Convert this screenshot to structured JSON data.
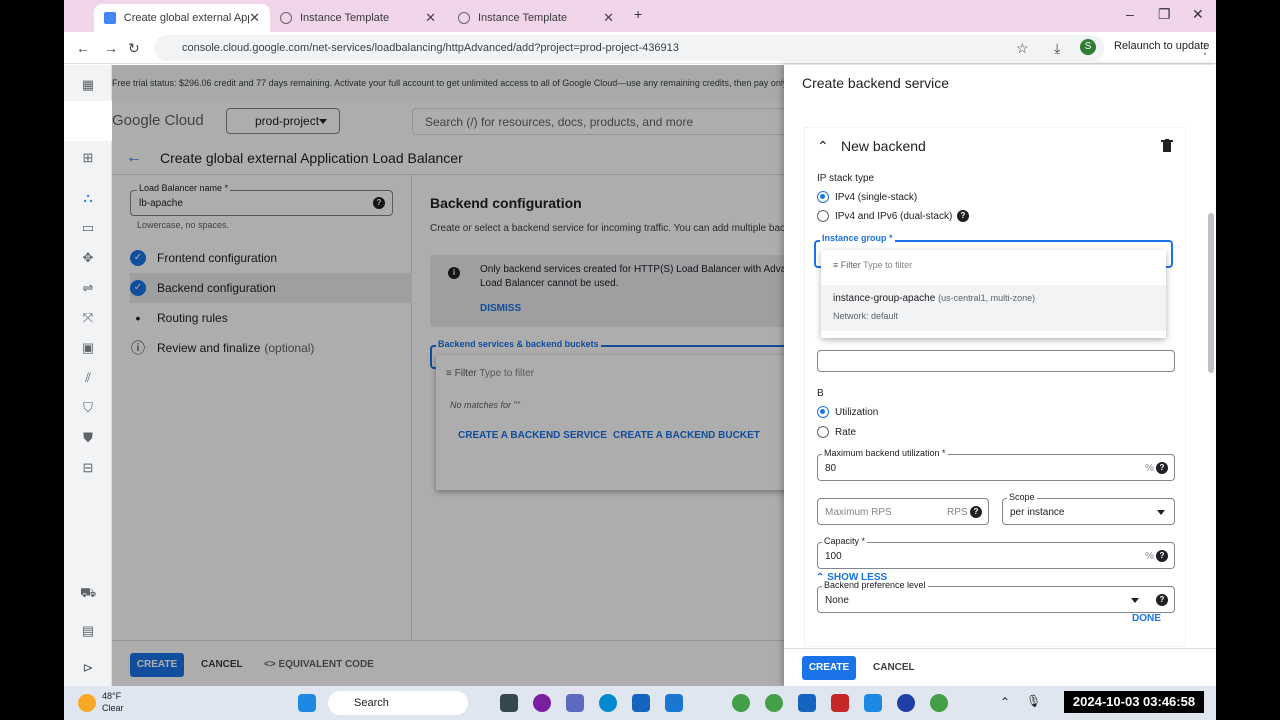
{
  "browser": {
    "tabs": [
      {
        "label": "Create global external Applicati",
        "active": true
      },
      {
        "label": "Instance Template",
        "active": false
      },
      {
        "label": "Instance Template",
        "active": false
      }
    ],
    "url": "console.cloud.google.com/net-services/loadbalancing/httpAdvanced/add?project=prod-project-436913",
    "relaunch_label": "Relaunch to update",
    "profile_initial": "S"
  },
  "console": {
    "trial_text": "Free trial status: $296.06 credit and 77 days remaining. Activate your full account to get unlimited access to all of Google Cloud—use any remaining credits, then pay only",
    "logo": "Google Cloud",
    "project": "prod-project",
    "search_placeholder": "Search (/) for resources, docs, products, and more",
    "page_title": "Create global external Application Load Balancer",
    "lb_name_label": "Load Balancer name *",
    "lb_name_value": "lb-apache",
    "lb_name_hint": "Lowercase, no spaces.",
    "steps": [
      {
        "label": "Frontend configuration",
        "state": "done"
      },
      {
        "label": "Backend configuration",
        "state": "done"
      },
      {
        "label": "Routing rules",
        "state": "todo"
      },
      {
        "label": "Review and finalize",
        "state": "info",
        "suffix": "(optional)"
      }
    ],
    "main_title": "Backend configuration",
    "main_desc": "Create or select a backend service for incoming traffic. You can add multiple backe",
    "info_text": "Only backend services created for HTTP(S) Load Balancer with Advanc Load Balancer cannot be used.",
    "dismiss_label": "DISMISS",
    "bs_label": "Backend services & backend buckets",
    "bs_filter": "Filter",
    "bs_filter_placeholder": "Type to filter",
    "no_matches": "No matches for \"\"",
    "create_backend_service": "CREATE A BACKEND SERVICE",
    "create_backend_bucket": "CREATE A BACKEND BUCKET",
    "create_label": "CREATE",
    "cancel_label": "CANCEL",
    "equivalent_code": "EQUIVALENT CODE"
  },
  "panel": {
    "title": "Create backend service",
    "new_backend": "New backend",
    "ip_stack_label": "IP stack type",
    "ip_options": [
      {
        "label": "IPv4 (single-stack)",
        "selected": true
      },
      {
        "label": "IPv4 and IPv6 (dual-stack)",
        "selected": false
      }
    ],
    "instance_group_label": "Instance group *",
    "ig_filter": "Filter",
    "ig_filter_placeholder": "Type to filter",
    "ig_option_name": "instance-group-apache",
    "ig_option_zone": "(us-central1, multi-zone)",
    "ig_option_network": "Network: default",
    "balancing_letter": "B",
    "balancing_options": [
      {
        "label": "Utilization",
        "selected": true
      },
      {
        "label": "Rate",
        "selected": false
      }
    ],
    "max_util_label": "Maximum backend utilization *",
    "max_util_value": "80",
    "percent": "%",
    "max_rps_placeholder": "Maximum RPS",
    "rps_unit": "RPS",
    "scope_label": "Scope",
    "scope_value": "per instance",
    "capacity_label": "Capacity *",
    "capacity_value": "100",
    "pref_label": "Backend preference level",
    "pref_value": "None",
    "show_less": "SHOW LESS",
    "done": "DONE",
    "create_label": "CREATE",
    "cancel_label": "CANCEL"
  },
  "taskbar": {
    "temp": "48°F",
    "weather": "Clear",
    "search": "Search",
    "clock": "2024-10-03 03:46:58"
  }
}
